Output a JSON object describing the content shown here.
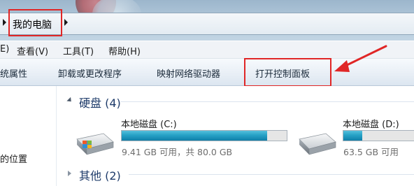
{
  "address": {
    "breadcrumb": "我的电脑"
  },
  "menu": {
    "items": [
      {
        "label": "E)"
      },
      {
        "label": "查看(V)"
      },
      {
        "label": "工具(T)"
      },
      {
        "label": "帮助(H)"
      }
    ]
  },
  "toolbar": {
    "items": [
      {
        "label": "统属性"
      },
      {
        "label": "卸载或更改程序"
      },
      {
        "label": "映射网络驱动器"
      },
      {
        "label": "打开控制面板"
      }
    ]
  },
  "nav": {
    "item": "的位置"
  },
  "groups": {
    "hdd": {
      "title": "硬盘 (4)",
      "drives": [
        {
          "name": "本地磁盘 (C:)",
          "info": "9.41 GB 可用，共 80.0 GB",
          "used_fraction": 0.88
        },
        {
          "name": "本地磁盘 (D:)",
          "info": "63.5 GB 可用",
          "used_fraction": 0.25
        }
      ]
    },
    "other": {
      "title": "其他 (2)"
    }
  },
  "colors": {
    "highlight": "#e02626",
    "drive_fill": "#1591b8"
  }
}
